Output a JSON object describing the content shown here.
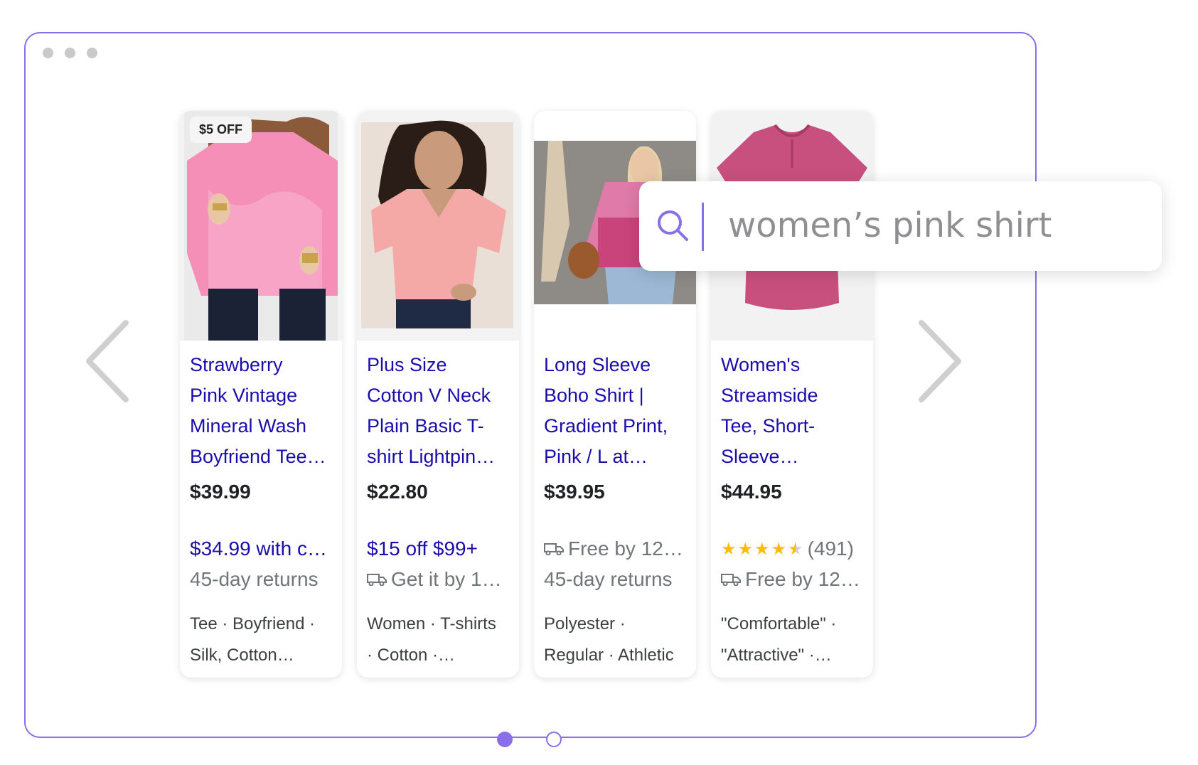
{
  "search": {
    "query": "women’s pink shirt"
  },
  "colors": {
    "accent": "#8a6fe8",
    "link": "#1a0dab",
    "star": "#fbbc04"
  },
  "products": [
    {
      "badge": "$5 OFF",
      "title_lines": [
        "Strawberry",
        "Pink Vintage",
        "Mineral Wash",
        "Boyfriend Tee…"
      ],
      "price": "$39.99",
      "promo": "$34.99 with c…",
      "delivery": "45-day returns",
      "tags": [
        "Tee · Boyfriend ·",
        "Silk, Cotton…"
      ]
    },
    {
      "title_lines": [
        "Plus Size",
        "Cotton V Neck",
        "Plain Basic T-",
        "shirt Lightpin…"
      ],
      "price": "$22.80",
      "promo": "$15 off $99+",
      "delivery": "Get it by 1…",
      "tags": [
        "Women · T-shirts",
        "· Cotton ·…"
      ]
    },
    {
      "title_lines": [
        "Long Sleeve",
        "Boho Shirt |",
        "Gradient Print,",
        "Pink / L at…"
      ],
      "price": "$39.95",
      "delivery": "Free by 12…",
      "returns": "45-day returns",
      "tags": [
        "Polyester ·",
        "Regular · Athletic"
      ]
    },
    {
      "title_lines": [
        "Women's",
        "Streamside",
        "Tee, Short-",
        "Sleeve…"
      ],
      "price": "$44.95",
      "rating": 4.5,
      "rating_count": "(491)",
      "delivery": "Free by 12…",
      "tags": [
        "\"Comfortable\" ·",
        "\"Attractive\" ·…"
      ]
    }
  ],
  "icons": [
    "search-icon",
    "truck-icon",
    "star-icon",
    "chevron-left-icon",
    "chevron-right-icon"
  ]
}
